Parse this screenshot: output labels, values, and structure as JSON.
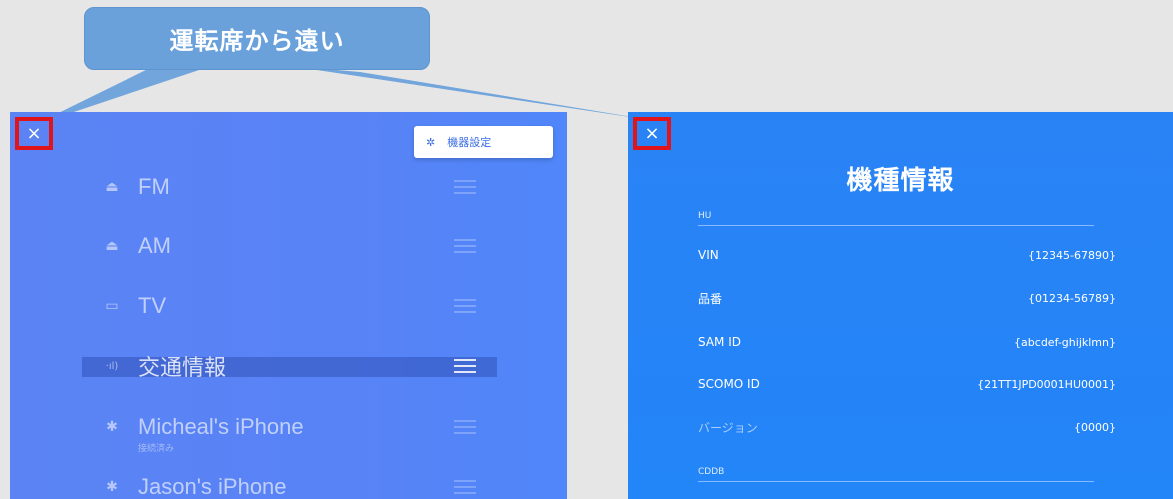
{
  "callout": {
    "text": "運転席から遠い"
  },
  "left_panel": {
    "close_icon": "×",
    "settings_button": {
      "icon": "✲",
      "label": "機器設定"
    },
    "sources": [
      {
        "icon": "radio-icon",
        "glyph": "⏏",
        "label": "FM",
        "sub": ""
      },
      {
        "icon": "radio-icon",
        "glyph": "⏏",
        "label": "AM",
        "sub": ""
      },
      {
        "icon": "tv-icon",
        "glyph": "▭",
        "label": "TV",
        "sub": ""
      },
      {
        "icon": "signal-icon",
        "glyph": "·ıl)",
        "label": "交通情報",
        "sub": ""
      },
      {
        "icon": "bluetooth-icon",
        "glyph": "✱",
        "label": "Micheal's iPhone",
        "sub": "接続済み"
      },
      {
        "icon": "bluetooth-icon",
        "glyph": "✱",
        "label": "Jason's iPhone",
        "sub": ""
      }
    ]
  },
  "right_panel": {
    "close_icon": "×",
    "title": "機種情報",
    "sections": [
      {
        "header": "HU"
      },
      {
        "header": "CDDB"
      }
    ],
    "rows": [
      {
        "label": "VIN",
        "value": "{12345-67890}"
      },
      {
        "label": "品番",
        "value": "{01234-56789}"
      },
      {
        "label": "SAM ID",
        "value": "{abcdef-ghijklmn}"
      },
      {
        "label": "SCOMO ID",
        "value": "{21TT1JPD0001HU0001}"
      },
      {
        "label": "バージョン",
        "value": "{0000}"
      }
    ]
  },
  "colors": {
    "callout": "#6aa1db",
    "left_panel": "#5883f6",
    "right_panel": "#2285f8",
    "close_highlight": "#e0141b"
  }
}
